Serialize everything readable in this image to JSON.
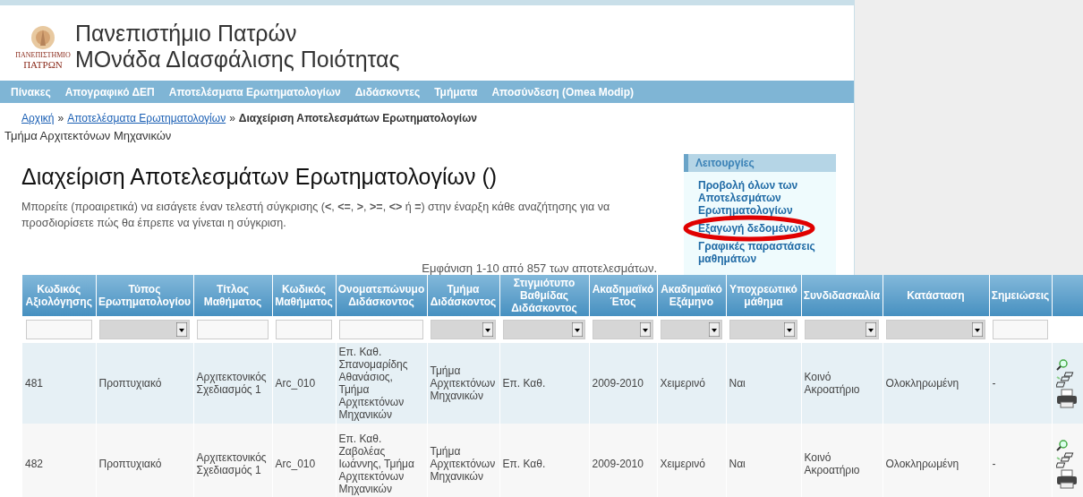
{
  "header": {
    "logo_text": [
      "ΠΑΝΕΠΙΣΤΗΜΙΟ",
      "ΠΑΤΡΩΝ"
    ],
    "title_lines": [
      "Πανεπιστήμιο Πατρών",
      "ΜΟνάδα ΔΙασφάλισης Ποιότητας"
    ]
  },
  "nav": [
    "Πίνακες",
    "Απογραφικό ΔΕΠ",
    "Αποτελέσματα Ερωτηματολογίων",
    "Διδάσκοντες",
    "Τμήματα",
    "Αποσύνδεση (Omea Modip)"
  ],
  "breadcrumb": {
    "links": [
      "Αρχική",
      "Αποτελέσματα Ερωτηματολογίων"
    ],
    "separator": "»",
    "current": "Διαχείριση Αποτελεσμάτων Ερωτηματολογίων"
  },
  "department": "Τμήμα Αρχιτεκτόνων Μηχανικών",
  "heading": "Διαχείριση Αποτελεσμάτων Ερωτηματολογίων ()",
  "help_text": "Μπορείτε (προαιρετικά) να εισάγετε έναν τελεστή σύγκρισης (**<**, **<=**, **>**, **>=**, **<>** ή **=**) στην έναρξη κάθε αναζήτησης για να προσδιορίσετε πώς θα έπρεπε να γίνεται η σύγκριση.",
  "sidebar": {
    "title": "Λειτουργίες",
    "items": [
      {
        "label": "Προβολή όλων των Αποτελεσμάτων Ερωτηματολογίων",
        "circled": false
      },
      {
        "label": "Εξαγωγή δεδομένων",
        "circled": true
      },
      {
        "label": "Γραφικές παραστάσεις μαθημάτων",
        "circled": false
      }
    ]
  },
  "summary": "Εμφάνιση 1-10 από 857 των αποτελεσμάτων.",
  "table": {
    "columns": [
      {
        "label": "Κωδικός Αξιολόγησης",
        "kind": "text"
      },
      {
        "label": "Τύπος Ερωτηματολογίου",
        "kind": "select"
      },
      {
        "label": "Τίτλος Μαθήματος",
        "kind": "text"
      },
      {
        "label": "Κωδικός Μαθήματος",
        "kind": "text"
      },
      {
        "label": "Ονοματεπώνυμο Διδάσκοντος",
        "kind": "text"
      },
      {
        "label": "Τμήμα Διδάσκοντος",
        "kind": "select"
      },
      {
        "label": "Στιγμιότυπο Βαθμίδας Διδάσκοντος",
        "kind": "select"
      },
      {
        "label": "Ακαδημαϊκό Έτος",
        "kind": "select"
      },
      {
        "label": "Ακαδημαϊκό Εξάμηνο",
        "kind": "select"
      },
      {
        "label": "Υποχρεωτικό μάθημα",
        "kind": "select"
      },
      {
        "label": "Συνδιδασκαλία",
        "kind": "select"
      },
      {
        "label": "Κατάσταση",
        "kind": "select"
      },
      {
        "label": "Σημειώσεις",
        "kind": "text"
      },
      {
        "kind": "actions"
      }
    ],
    "rows": [
      {
        "cells": [
          "481",
          "Προπτυχιακό",
          "Αρχιτεκτονικός Σχεδιασμός 1",
          "Arc_010",
          "Επ. Καθ. Σπανομαρίδης Αθανάσιος, Τμήμα Αρχιτεκτόνων Μηχανικών",
          "Τμήμα Αρχιτεκτόνων Μηχανικών",
          "Επ. Καθ.",
          "2009-2010",
          "Χειμερινό",
          "Ναι",
          "Κοινό Ακροατήριο",
          "Ολοκληρωμένη",
          "-"
        ]
      },
      {
        "cells": [
          "482",
          "Προπτυχιακό",
          "Αρχιτεκτονικός Σχεδιασμός 1",
          "Arc_010",
          "Επ. Καθ. Ζαβολέας Ιωάννης, Τμήμα Αρχιτεκτόνων Μηχανικών",
          "Τμήμα Αρχιτεκτόνων Μηχανικών",
          "Επ. Καθ.",
          "2009-2010",
          "Χειμερινό",
          "Ναι",
          "Κοινό Ακροατήριο",
          "Ολοκληρωμένη",
          "-"
        ]
      }
    ]
  }
}
